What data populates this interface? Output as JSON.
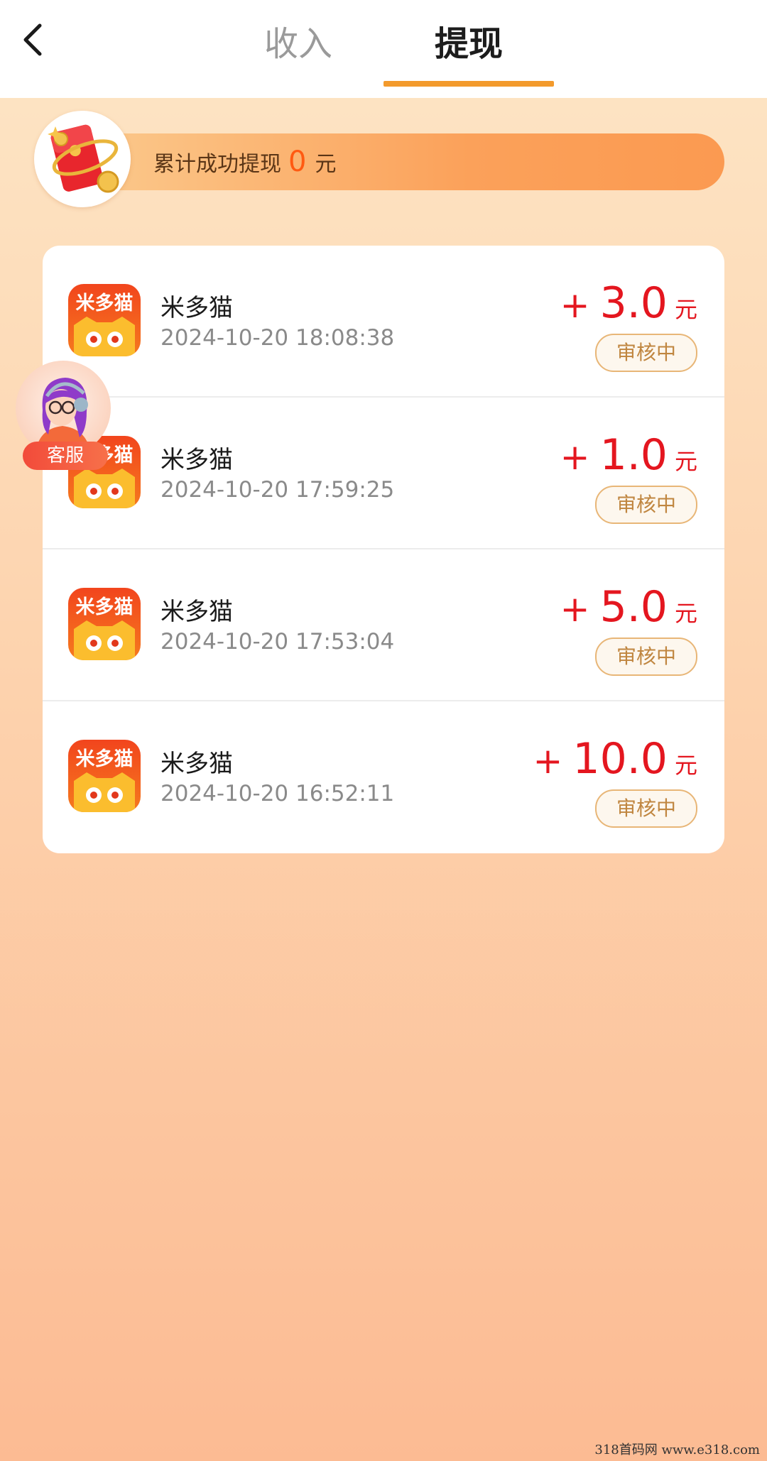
{
  "header": {
    "tabs": [
      {
        "label": "收入",
        "active": false
      },
      {
        "label": "提现",
        "active": true
      }
    ]
  },
  "summary": {
    "prefix": "累计成功提现",
    "amount": "0",
    "unit": "元"
  },
  "records": [
    {
      "app_name": "米多猫",
      "time": "2024-10-20 18:08:38",
      "sign": "+",
      "amount": "3.0",
      "unit": "元",
      "status": "审核中"
    },
    {
      "app_name": "米多猫",
      "time": "2024-10-20 17:59:25",
      "sign": "+",
      "amount": "1.0",
      "unit": "元",
      "status": "审核中"
    },
    {
      "app_name": "米多猫",
      "time": "2024-10-20 17:53:04",
      "sign": "+",
      "amount": "5.0",
      "unit": "元",
      "status": "审核中"
    },
    {
      "app_name": "米多猫",
      "time": "2024-10-20 16:52:11",
      "sign": "+",
      "amount": "10.0",
      "unit": "元",
      "status": "审核中"
    }
  ],
  "app_icon": {
    "text": "米多猫",
    "icon": "midomao-cat-icon"
  },
  "customer_service": {
    "label": "客服",
    "icon": "customer-service-avatar-icon"
  },
  "watermark": "318首码网  www.e318.com",
  "colors": {
    "accent": "#f39a2c",
    "amount_red": "#e4161f",
    "summary_amount": "#ff5a12",
    "status_text": "#c08640"
  }
}
